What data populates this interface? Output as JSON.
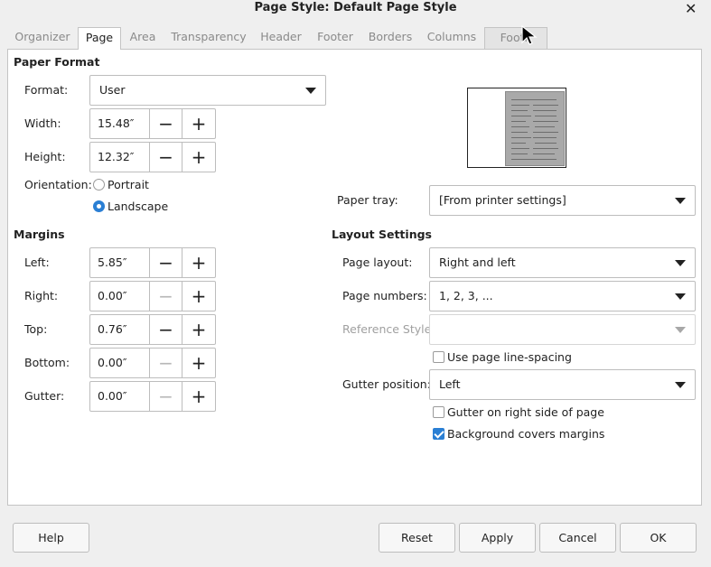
{
  "window": {
    "title": "Page Style: Default Page Style"
  },
  "tabs": [
    {
      "label": "Organizer"
    },
    {
      "label": "Page"
    },
    {
      "label": "Area"
    },
    {
      "label": "Transparency"
    },
    {
      "label": "Header"
    },
    {
      "label": "Footer"
    },
    {
      "label": "Borders"
    },
    {
      "label": "Columns"
    },
    {
      "label": "Footn"
    }
  ],
  "active_tab": "Page",
  "paper_format": {
    "heading": "Paper Format",
    "format_label": "Format:",
    "format_value": "User",
    "width_label": "Width:",
    "width_value": "15.48″",
    "height_label": "Height:",
    "height_value": "12.32″",
    "orientation_label": "Orientation:",
    "portrait_label": "Portrait",
    "landscape_label": "Landscape",
    "orientation_selected": "Landscape"
  },
  "paper_tray": {
    "label": "Paper tray:",
    "value": "[From printer settings]"
  },
  "margins": {
    "heading": "Margins",
    "left_label": "Left:",
    "left_value": "5.85″",
    "right_label": "Right:",
    "right_value": "0.00″",
    "top_label": "Top:",
    "top_value": "0.76″",
    "bottom_label": "Bottom:",
    "bottom_value": "0.00″",
    "gutter_label": "Gutter:",
    "gutter_value": "0.00″"
  },
  "layout_settings": {
    "heading": "Layout Settings",
    "page_layout_label": "Page layout:",
    "page_layout_value": "Right and left",
    "page_numbers_label": "Page numbers:",
    "page_numbers_value": "1, 2, 3, ...",
    "reference_style_label": "Reference Style:",
    "reference_style_value": "",
    "use_line_spacing_label": "Use page line-spacing",
    "use_line_spacing_checked": false,
    "gutter_position_label": "Gutter position:",
    "gutter_position_value": "Left",
    "gutter_right_label": "Gutter on right side of page",
    "gutter_right_checked": false,
    "bg_covers_label": "Background covers margins",
    "bg_covers_checked": true
  },
  "buttons": {
    "help": "Help",
    "reset": "Reset",
    "apply": "Apply",
    "cancel": "Cancel",
    "ok": "OK"
  },
  "colors": {
    "accent": "#2a7fd4",
    "panel": "#ffffff",
    "window": "#efefef"
  }
}
